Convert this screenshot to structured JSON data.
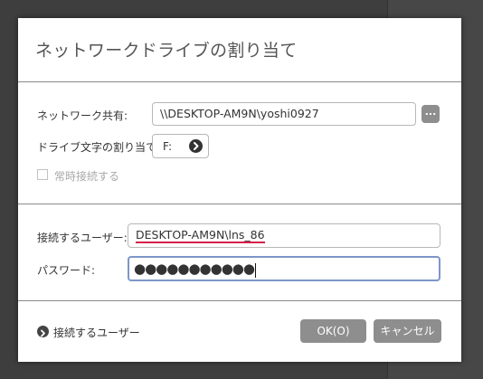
{
  "dialog": {
    "title": "ネットワークドライブの割り当て",
    "network_share": {
      "label": "ネットワーク共有:",
      "value": "\\\\DESKTOP-AM9N\\yoshi0927",
      "browse_label": "..."
    },
    "drive_letter": {
      "label": "ドライブ文字の割り当て:",
      "value": "F:",
      "arrow_icon": "chevron-right-icon"
    },
    "persistent": {
      "label": "常時接続する",
      "checked": false
    },
    "user": {
      "label": "接続するユーザー:",
      "value": "DESKTOP-AM9N\\lns_86"
    },
    "password": {
      "label": "パスワード:",
      "value": "●●●●●●●●●●●"
    },
    "footer": {
      "expander_label": "接続するユーザー",
      "ok_label": "OK(O)",
      "cancel_label": "キャンセル(C)"
    }
  },
  "colors": {
    "button": "#8e8e8e",
    "underline": "#d6204a",
    "focus_border": "#7d96c9"
  }
}
